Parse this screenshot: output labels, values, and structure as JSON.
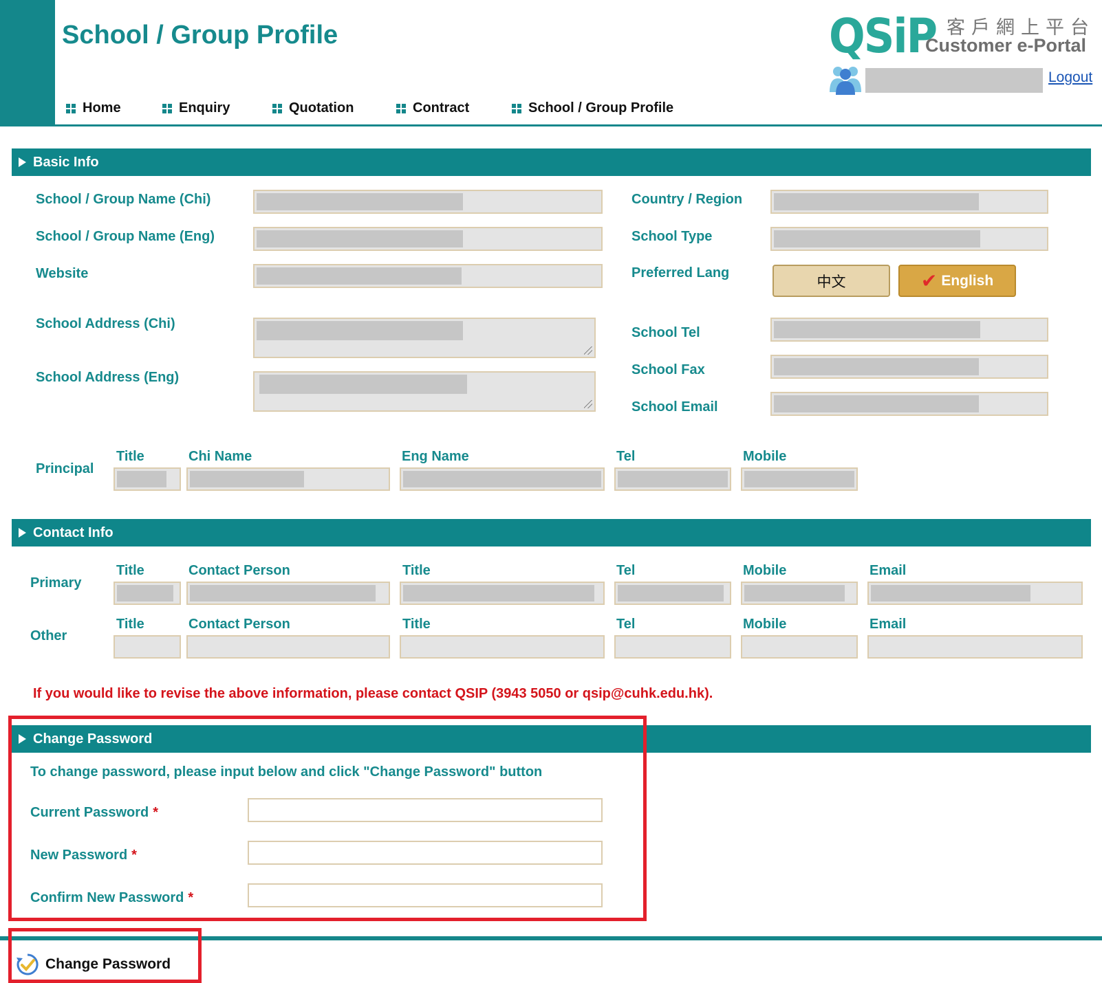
{
  "header": {
    "page_title": "School / Group Profile",
    "logo_text": "QSiP",
    "portal_chi": "客戶網上平台",
    "portal_eng": "Customer e-Portal",
    "logout": "Logout"
  },
  "nav": {
    "items": [
      "Home",
      "Enquiry",
      "Quotation",
      "Contract",
      "School / Group Profile"
    ]
  },
  "basic_info": {
    "heading": "Basic Info",
    "school_name_chi": "School / Group Name (Chi)",
    "school_name_eng": "School / Group Name (Eng)",
    "website": "Website",
    "address_chi": "School Address (Chi)",
    "address_eng": "School Address (Eng)",
    "country_region": "Country / Region",
    "school_type": "School Type",
    "preferred_lang": "Preferred Lang",
    "lang_chi": "中文",
    "lang_eng": "English",
    "school_tel": "School Tel",
    "school_fax": "School Fax",
    "school_email": "School Email",
    "principal": "Principal",
    "principal_cols": [
      "Title",
      "Chi Name",
      "Eng Name",
      "Tel",
      "Mobile"
    ]
  },
  "contact_info": {
    "heading": "Contact Info",
    "primary": "Primary",
    "other": "Other",
    "cols": [
      "Title",
      "Contact Person",
      "Title",
      "Tel",
      "Mobile",
      "Email"
    ]
  },
  "notice": "If you would like to revise the above information, please contact QSIP (3943 5050 or qsip@cuhk.edu.hk).",
  "change_password": {
    "heading": "Change Password",
    "intro": "To change password, please input below and click \"Change Password\" button",
    "current": "Current Password",
    "new": "New Password",
    "confirm": "Confirm New Password",
    "required_mark": "*",
    "button": "Change Password"
  },
  "colors": {
    "teal": "#0f868a",
    "highlight_red": "#e3202c",
    "notice_red": "#d4141b"
  }
}
